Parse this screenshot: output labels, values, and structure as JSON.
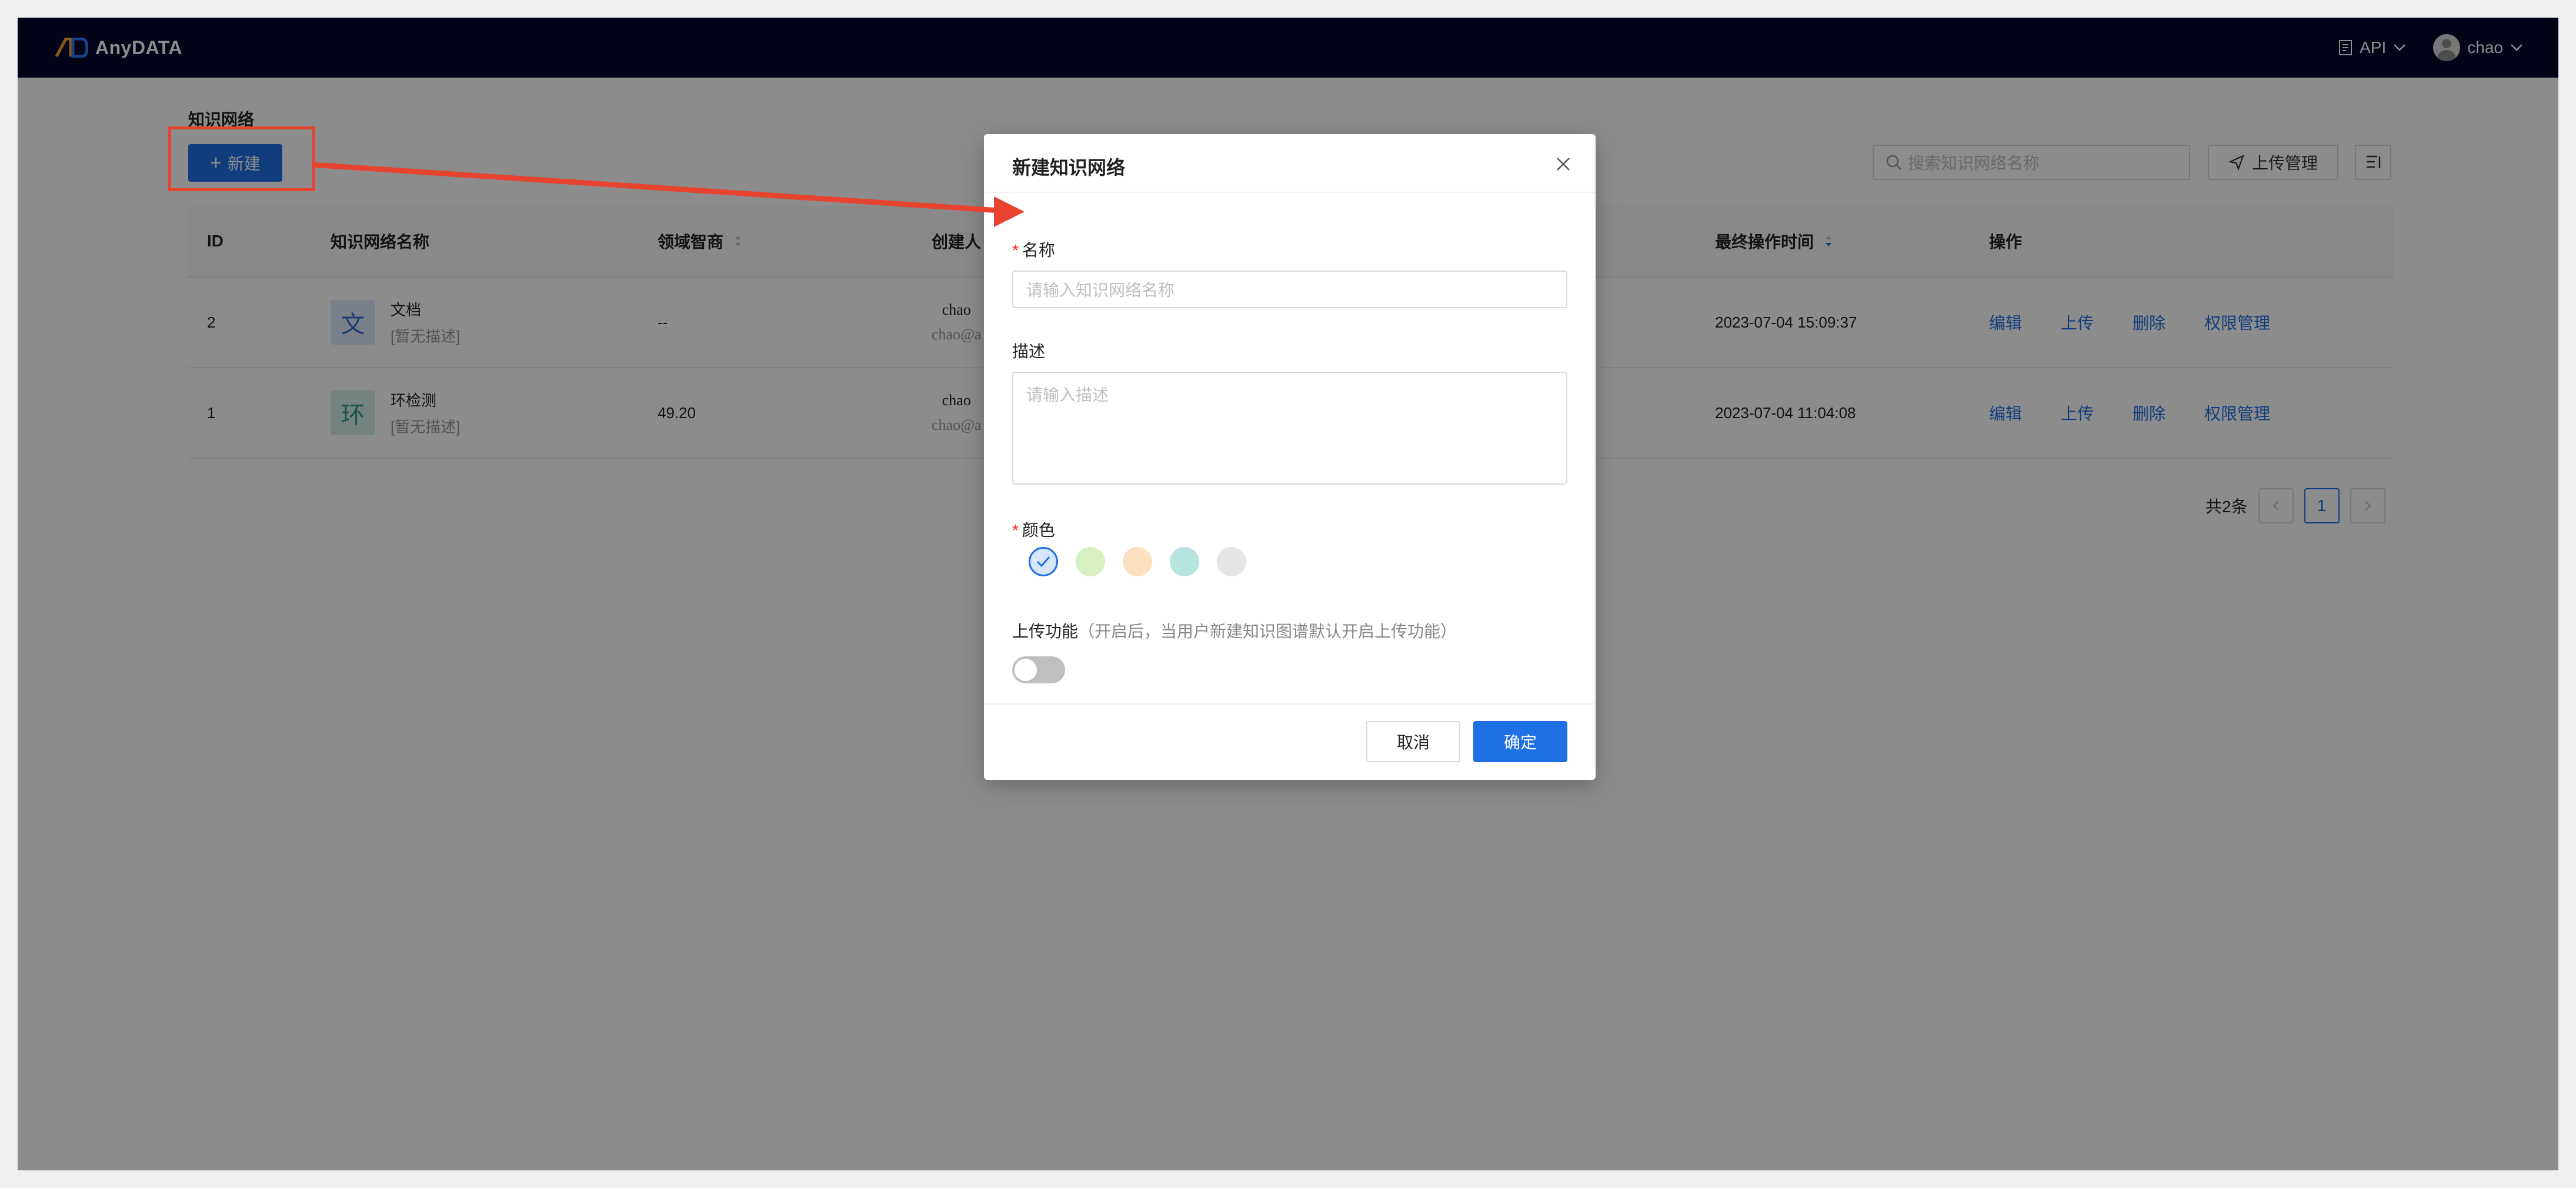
{
  "topbar": {
    "logo_text": "AnyDATA",
    "api_label": "API",
    "user_name": "chao"
  },
  "page": {
    "title": "知识网络",
    "new_button": "新建",
    "search_placeholder": "搜索知识网络名称",
    "upload_manage": "上传管理"
  },
  "table": {
    "headers": [
      "ID",
      "知识网络名称",
      "领域智商",
      "创建人",
      "最终操作时间",
      "操作"
    ],
    "rows": [
      {
        "id": "2",
        "icon_char": "文",
        "name": "文档",
        "desc": "[暂无描述]",
        "iq": "--",
        "creator": "chao",
        "creator_email": "chao@a",
        "time": "2023-07-04 15:09:37"
      },
      {
        "id": "1",
        "icon_char": "环",
        "name": "环检测",
        "desc": "[暂无描述]",
        "iq": "49.20",
        "creator": "chao",
        "creator_email": "chao@a",
        "time": "2023-07-04 11:04:08"
      }
    ],
    "ops": [
      "编辑",
      "上传",
      "删除",
      "权限管理"
    ]
  },
  "pager": {
    "total": "共2条",
    "current": "1"
  },
  "modal": {
    "title": "新建知识网络",
    "name_label": "名称",
    "name_placeholder": "请输入知识网络名称",
    "desc_label": "描述",
    "desc_placeholder": "请输入描述",
    "color_label": "颜色",
    "colors": [
      "#d6e6fb",
      "#d8efc0",
      "#fde0bf",
      "#b7e4de",
      "#e5e5e5"
    ],
    "selected_color": 0,
    "upload_label": "上传功能",
    "upload_hint": "（开启后，当用户新建知识图谱默认开启上传功能）",
    "upload_enabled": false,
    "cancel": "取消",
    "ok": "确定"
  },
  "colors": {
    "accent": "#1f6fe5",
    "topbar": "#05072a",
    "annotation": "#e8432f"
  }
}
